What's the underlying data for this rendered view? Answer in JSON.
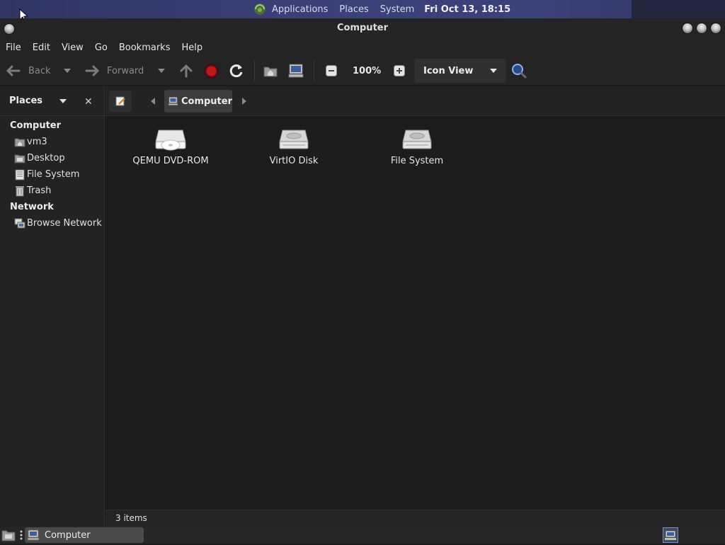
{
  "top_panel": {
    "menus": [
      "Applications",
      "Places",
      "System"
    ],
    "clock": "Fri Oct 13, 18:15"
  },
  "window": {
    "title": "Computer"
  },
  "menubar": [
    "File",
    "Edit",
    "View",
    "Go",
    "Bookmarks",
    "Help"
  ],
  "toolbar": {
    "back_label": "Back",
    "forward_label": "Forward",
    "zoom_level": "100%",
    "view_mode": "Icon View"
  },
  "sidebar": {
    "title": "Places",
    "sections": [
      {
        "label": "Computer",
        "items": [
          "vm3",
          "Desktop",
          "File System",
          "Trash"
        ]
      },
      {
        "label": "Network",
        "items": [
          "Browse Network"
        ]
      }
    ]
  },
  "location": {
    "current": "Computer"
  },
  "files": [
    {
      "name": "QEMU DVD-ROM",
      "icon": "optical-drive-icon"
    },
    {
      "name": "VirtIO Disk",
      "icon": "hard-disk-icon"
    },
    {
      "name": "File System",
      "icon": "hard-disk-icon"
    }
  ],
  "status": {
    "text": "3 items"
  },
  "taskbar": {
    "task_label": "Computer"
  }
}
